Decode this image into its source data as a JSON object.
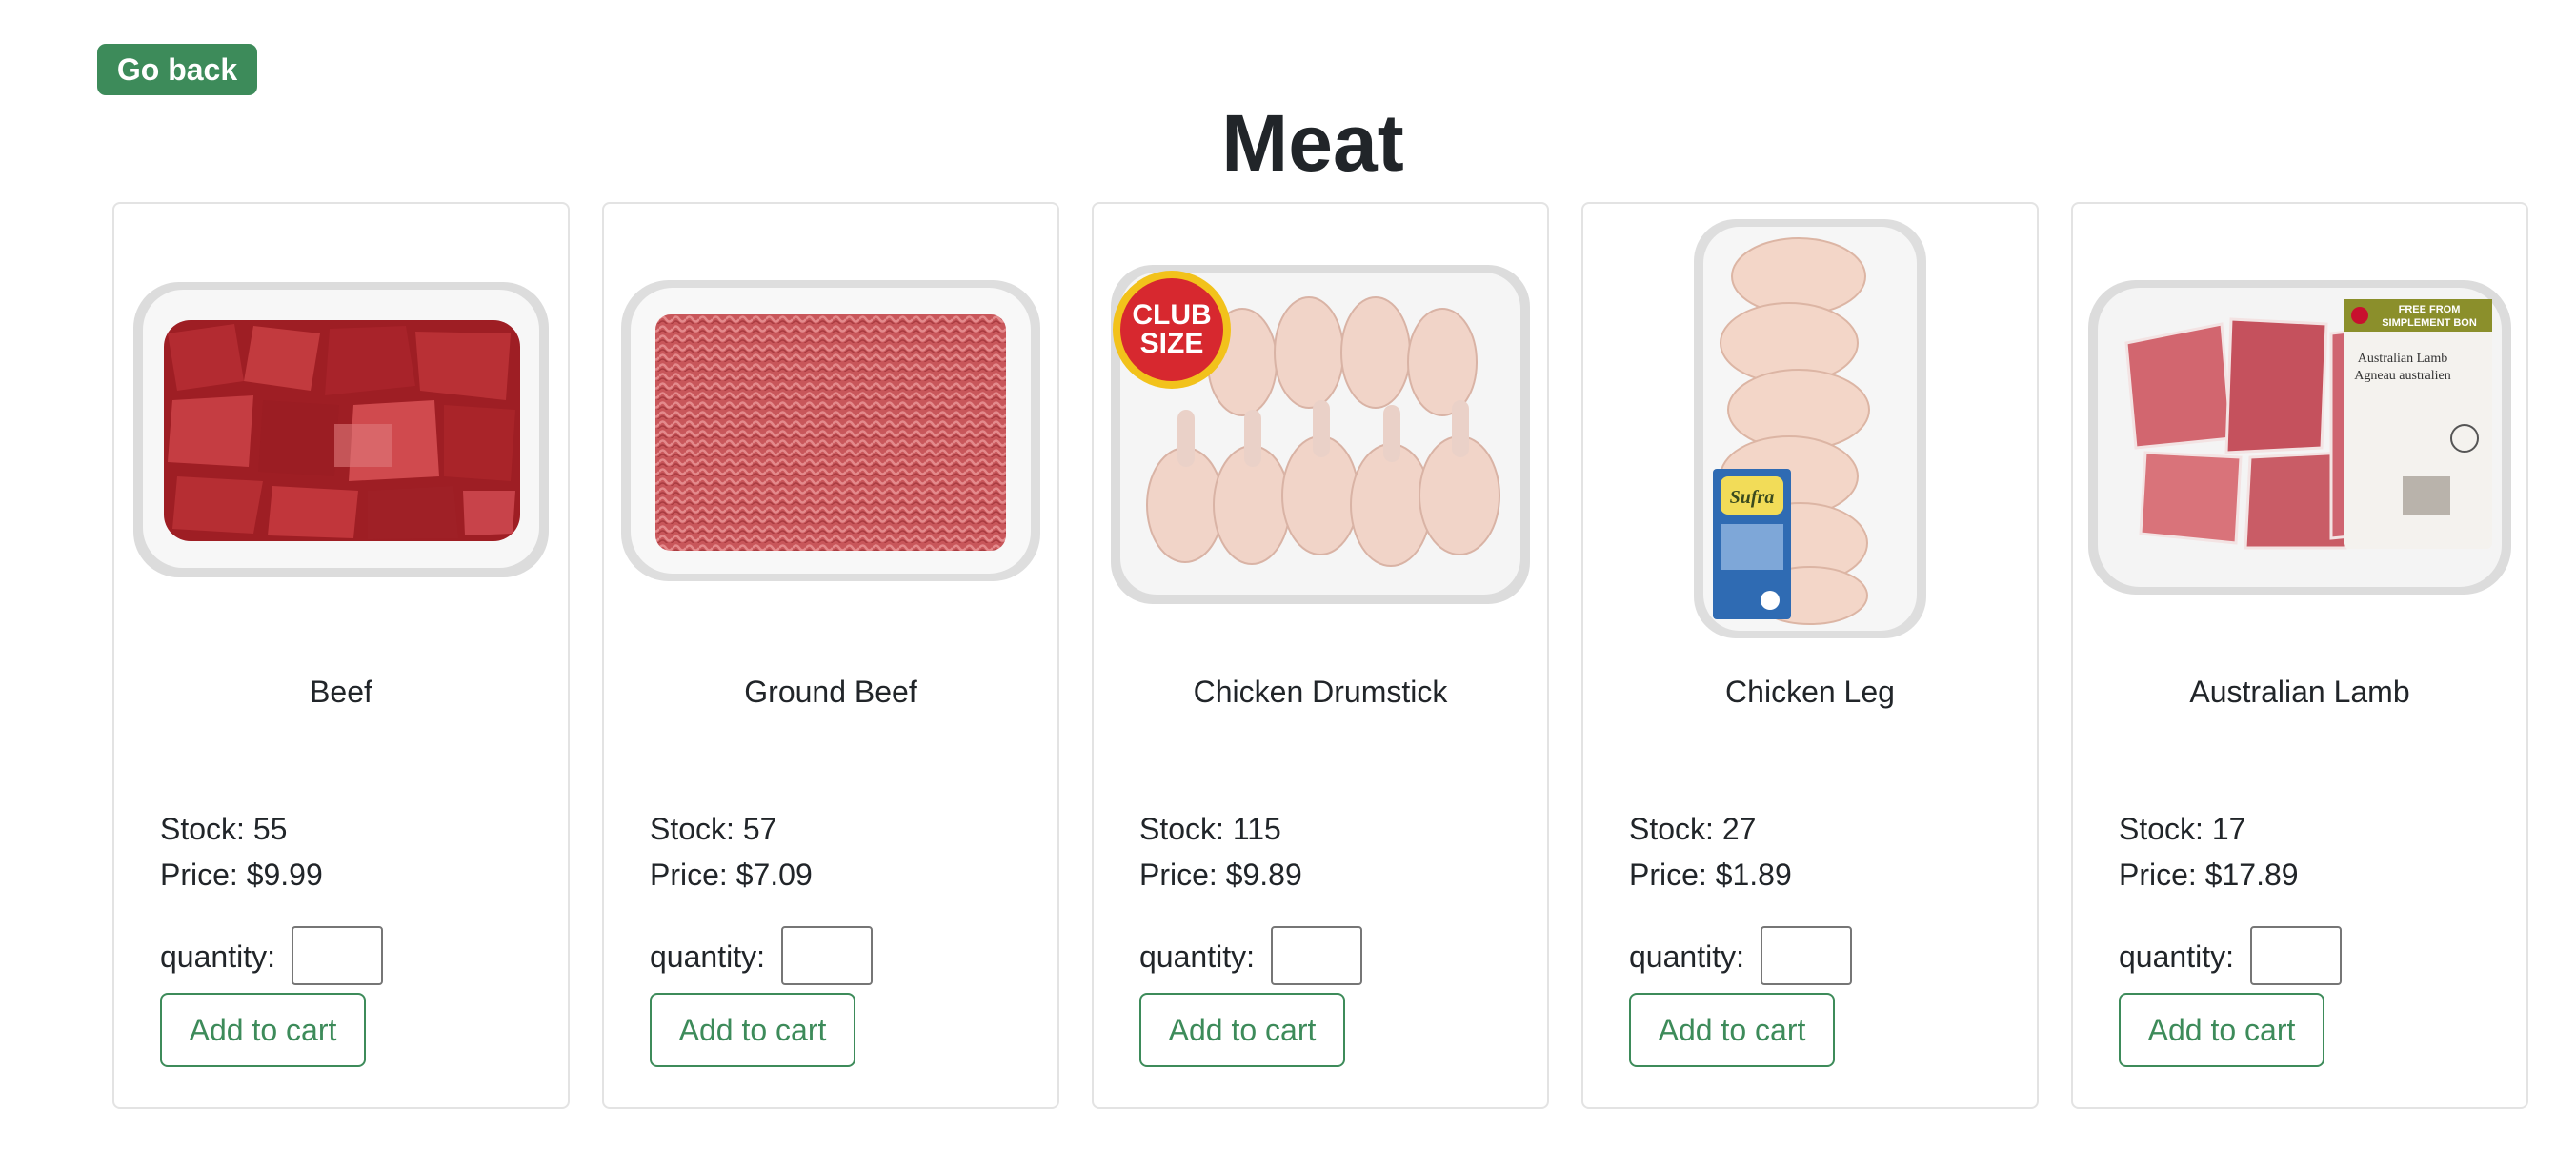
{
  "nav": {
    "back_label": "Go back"
  },
  "page": {
    "title": "Meat"
  },
  "labels": {
    "stock_prefix": "Stock: ",
    "price_prefix": "Price: ",
    "quantity": "quantity:",
    "add_to_cart": "Add to cart"
  },
  "colors": {
    "accent": "#3d8b5a",
    "card_border": "#e3e3e3",
    "text": "#212529"
  },
  "products": [
    {
      "name": "Beef",
      "stock": "55",
      "price": "$9.99",
      "quantity": "",
      "image_icon": "beef-cubes-tray-image"
    },
    {
      "name": "Ground Beef",
      "stock": "57",
      "price": "$7.09",
      "quantity": "",
      "image_icon": "ground-beef-tray-image"
    },
    {
      "name": "Chicken Drumstick",
      "stock": "115",
      "price": "$9.89",
      "quantity": "",
      "image_icon": "chicken-drumsticks-tray-image",
      "image_badge": [
        "CLUB",
        "SIZE"
      ]
    },
    {
      "name": "Chicken Leg",
      "stock": "27",
      "price": "$1.89",
      "quantity": "",
      "image_icon": "chicken-legs-tray-image",
      "image_label": "Sufra"
    },
    {
      "name": "Australian Lamb",
      "stock": "17",
      "price": "$17.89",
      "quantity": "",
      "image_icon": "lamb-tray-image",
      "image_label": [
        "FREE FROM",
        "SIMPLEMENT BON",
        "Australian Lamb",
        "Agneau australien"
      ]
    }
  ]
}
